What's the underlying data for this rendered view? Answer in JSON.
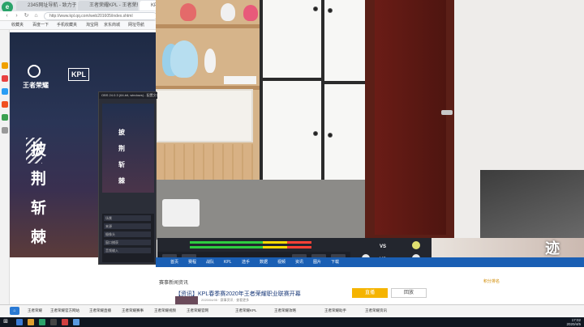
{
  "browser": {
    "tabs": [
      {
        "label": "2345网址导航 - 致力于提供"
      },
      {
        "label": "王者荣耀KPL - 王者荣耀"
      },
      {
        "label": "KPL直播_王者荣耀职业联赛"
      }
    ],
    "url": "http://www.kpl.qq.com/web201605/index.shtml",
    "bookmarks": [
      "收藏夹",
      "百度一下",
      "手机收藏夹",
      "淘宝网",
      "京东商城",
      "网址导航"
    ]
  },
  "poster": {
    "logo": "王者荣耀",
    "logo2": "KPL",
    "chars": [
      "披",
      "荆",
      "斩",
      "棘"
    ]
  },
  "obs": {
    "title": "OBS 24.0.3 (64-bit, windows) - 配置文件",
    "preview_chars": [
      "披",
      "荆",
      "斩",
      "棘"
    ],
    "rows": [
      "场景",
      "来源",
      "摄像头",
      "窗口捕获",
      "音频输入"
    ]
  },
  "overlay": {
    "vs": "VS",
    "right_char": "迹"
  },
  "site_nav": [
    "首页",
    "赛程",
    "战队",
    "KPL",
    "选手",
    "数据",
    "视频",
    "资讯",
    "图片",
    "下载"
  ],
  "news": {
    "section": "赛事新闻资讯",
    "title": "【资讯】KPL春季赛2020年王者荣耀职业联赛开幕",
    "meta": "2020/04/05 · 赛事资讯 · 查看更多",
    "ranking": "积分排名",
    "btn_a": "直播",
    "btn_b": "回放"
  },
  "bottom_bar": [
    "王者荣耀",
    "王者荣耀官方网站",
    "王者荣耀直播",
    "王者荣耀赛事",
    "王者荣耀视频",
    "王者荣耀官网",
    "王者荣耀KPL",
    "王者荣耀攻略",
    "王者荣耀助手",
    "王者荣耀资讯"
  ],
  "clock": {
    "time": "17:02",
    "date": "2020/4/5"
  }
}
